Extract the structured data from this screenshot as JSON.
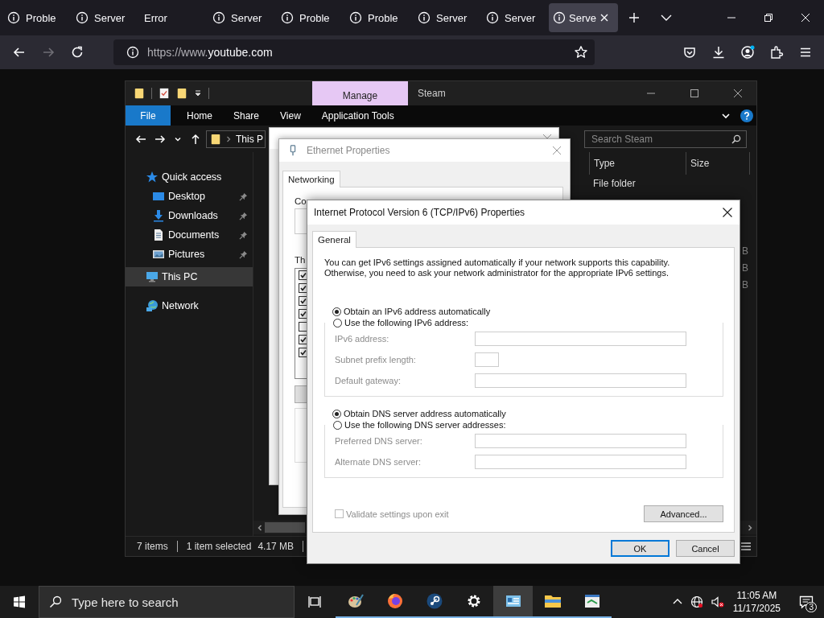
{
  "browser": {
    "tabs": [
      {
        "title": "Proble",
        "icon": true,
        "selected": false
      },
      {
        "title": "Server",
        "icon": true,
        "selected": false
      },
      {
        "title": "Error",
        "icon": false,
        "selected": false
      },
      {
        "title": "Server",
        "icon": true,
        "selected": false
      },
      {
        "title": "Proble",
        "icon": true,
        "selected": false
      },
      {
        "title": "Proble",
        "icon": true,
        "selected": false
      },
      {
        "title": "Server",
        "icon": true,
        "selected": false
      },
      {
        "title": "Server",
        "icon": true,
        "selected": false
      },
      {
        "title": "Serve",
        "icon": true,
        "selected": true
      }
    ],
    "url": {
      "prefix": "https://www.",
      "domain": "youtube.com"
    }
  },
  "explorer": {
    "context_tab": "Manage",
    "title": "Steam",
    "ribbon_tabs": [
      {
        "label": "File",
        "kind": "file"
      },
      {
        "label": "Home",
        "kind": "tab"
      },
      {
        "label": "Share",
        "kind": "tab"
      },
      {
        "label": "View",
        "kind": "tab"
      },
      {
        "label": "Application Tools",
        "kind": "tab"
      }
    ],
    "breadcrumb": "This P",
    "search": {
      "placeholder": "Search Steam"
    },
    "nav": [
      {
        "label": "Quick access",
        "kind": "star",
        "selected": false,
        "children": [
          {
            "label": "Desktop",
            "kind": "desktop",
            "selected": false,
            "pinned": true
          },
          {
            "label": "Downloads",
            "kind": "download",
            "selected": false,
            "pinned": true
          },
          {
            "label": "Documents",
            "kind": "document",
            "selected": false,
            "pinned": true
          },
          {
            "label": "Pictures",
            "kind": "pictures",
            "selected": false,
            "pinned": true
          }
        ]
      },
      {
        "label": "This PC",
        "kind": "pc",
        "selected": true
      },
      {
        "label": "Network",
        "kind": "network",
        "selected": false
      }
    ],
    "columns": [
      "Type",
      "Size"
    ],
    "rows": [
      {
        "type": "File folder"
      },
      {},
      {},
      {},
      {
        "size": "B"
      },
      {
        "size": "B"
      },
      {
        "size": "B"
      }
    ],
    "status": {
      "count": "7 items",
      "selection": "1 item selected",
      "size": "4.17 MB"
    }
  },
  "ethernet_properties": {
    "title": "Ethernet Properties",
    "tab": "Networking",
    "connect_label": "Co",
    "list_label": "Th",
    "components": [
      {
        "checked": true
      },
      {
        "checked": true
      },
      {
        "checked": true
      },
      {
        "checked": true
      },
      {
        "checked": false
      },
      {
        "checked": true
      },
      {
        "checked": true
      }
    ]
  },
  "dialog": {
    "title": "Internet Protocol Version 6 (TCP/IPv6) Properties",
    "tab": "General",
    "intro": [
      "You can get IPv6 settings assigned automatically if your network supports this capability.",
      "Otherwise, you need to ask your network administrator for the appropriate IPv6 settings."
    ],
    "sections": [
      {
        "options": [
          {
            "label": "Obtain an IPv6 address automatically",
            "selected": true
          },
          {
            "label": "Use the following IPv6 address:",
            "selected": false
          }
        ],
        "fields": [
          {
            "label": "IPv6 address:",
            "kind": "wide",
            "disabled": true
          },
          {
            "label": "Subnet prefix length:",
            "kind": "short",
            "disabled": true
          },
          {
            "label": "Default gateway:",
            "kind": "wide",
            "disabled": true
          }
        ]
      },
      {
        "options": [
          {
            "label": "Obtain DNS server address automatically",
            "selected": true
          },
          {
            "label": "Use the following DNS server addresses:",
            "selected": false
          }
        ],
        "fields": [
          {
            "label": "Preferred DNS server:",
            "kind": "wide",
            "disabled": true
          },
          {
            "label": "Alternate DNS server:",
            "kind": "wide",
            "disabled": true
          }
        ]
      }
    ],
    "validate": {
      "label": "Validate settings upon exit",
      "checked": false,
      "disabled": true
    },
    "advanced": "Advanced...",
    "ok": "OK",
    "cancel": "Cancel"
  },
  "taskbar": {
    "search_placeholder": "Type here to search",
    "apps": [
      {
        "kind": "paint",
        "selected": false
      },
      {
        "kind": "firefox",
        "selected": false
      },
      {
        "kind": "steam",
        "selected": false
      },
      {
        "kind": "settings",
        "selected": false
      },
      {
        "kind": "control",
        "selected": true
      },
      {
        "kind": "explorer",
        "selected": false
      },
      {
        "kind": "network",
        "selected": false
      }
    ],
    "time": "11:05 AM",
    "date": "11/17/2025",
    "notifications": "3"
  }
}
